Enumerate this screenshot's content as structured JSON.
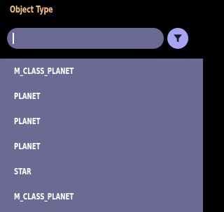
{
  "header": {
    "title": "Object Type"
  },
  "search": {
    "value": "",
    "filter_icon": "filter-funnel-icon"
  },
  "options": [
    "M_CLASS_PLANET",
    "PLANET",
    "PLANET",
    "PLANET",
    "STAR",
    "M_CLASS_PLANET"
  ],
  "colors": {
    "background": "#000000",
    "title": "#f4c389",
    "field": "#6b6a92",
    "accent": "#a9a4f2",
    "text": "#ffffff"
  }
}
